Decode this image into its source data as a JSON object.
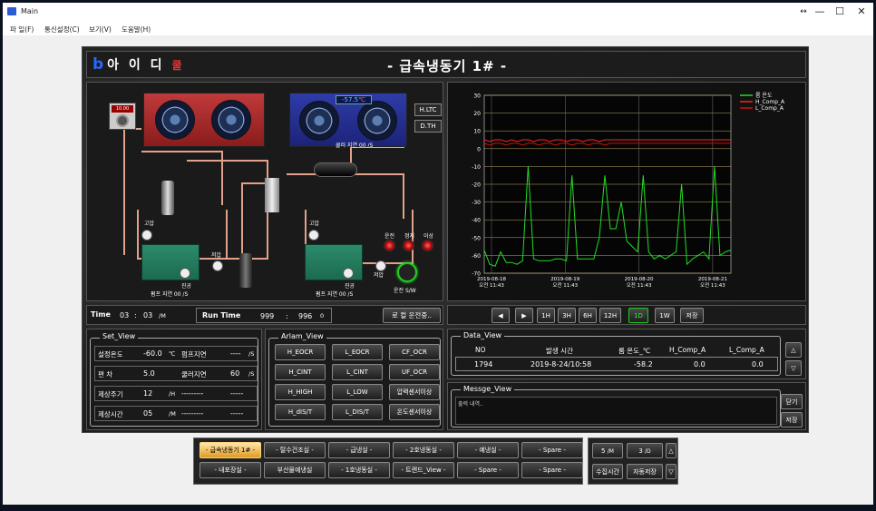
{
  "window": {
    "title": "Main",
    "controls": {
      "resize": "↔",
      "minimize": "—",
      "maximize": "☐",
      "close": "✕"
    }
  },
  "menu": [
    "파 일(F)",
    "통신설정(C)",
    "보기(V)",
    "도움말(H)"
  ],
  "header": {
    "logo_a": "b",
    "logo_b": "아 이 디",
    "logo_c": "쿨",
    "title": "- 급속냉동기 1# -"
  },
  "diagram": {
    "temp_small": "10.00",
    "temp_main": "-57.5",
    "temp_unit": "℃",
    "btn_hltc": "H.LTC",
    "btn_dth": "D.TH",
    "fan_delay": "쿨러 지연  00  /S",
    "left_high": "고압",
    "left_low": "저압",
    "left_vac": "진공",
    "left_pump": "펌프 지연  00  /S",
    "right_high": "고압",
    "right_low": "저압",
    "right_vac": "진공",
    "right_pump": "펌프 지연  00  /S",
    "led_labels": [
      "운전",
      "정지",
      "이상"
    ],
    "run_sw": "운전 S/W"
  },
  "chart_data": {
    "type": "line",
    "ylim": [
      -70,
      30
    ],
    "yticks": [
      "30",
      "20",
      "10",
      "0",
      "-10",
      "-20",
      "-30",
      "-40",
      "-50",
      "-60",
      "-70"
    ],
    "xticks": [
      [
        "2019-08-18",
        "오전 11:43"
      ],
      [
        "2019-08-19",
        "오전 11:43"
      ],
      [
        "2019-08-20",
        "오전 11:43"
      ],
      [
        "2019-08-21",
        "오전 11:43"
      ]
    ],
    "series": [
      {
        "name": "룸 온도",
        "color": "#22dd22",
        "values": [
          -57,
          -65,
          -66,
          -58,
          -64,
          -64,
          -65,
          -63,
          -10,
          -62,
          -63,
          -63,
          -63,
          -62,
          -62,
          -63,
          -15,
          -62,
          -62,
          -62,
          -62,
          -50,
          -15,
          -45,
          -45,
          -30,
          -52,
          -55,
          -58,
          -15,
          -58,
          -62,
          -60,
          -62,
          -60,
          -58,
          -20,
          -65,
          -62,
          -60,
          -58,
          -62,
          -10,
          -60,
          -58,
          -57
        ]
      },
      {
        "name": "H_Comp_A",
        "color": "#ff2222",
        "values": [
          5,
          4,
          5,
          5,
          4,
          5,
          4,
          5,
          5,
          4,
          5,
          5,
          4,
          5,
          5,
          4,
          5,
          5,
          4,
          5,
          5,
          4,
          5,
          5,
          5,
          5,
          5,
          5,
          5,
          5,
          5,
          5,
          5,
          5,
          5,
          5,
          5,
          5,
          5,
          5,
          5,
          5,
          5,
          5,
          5,
          5
        ]
      },
      {
        "name": "L_Comp_A",
        "color": "#cc1111",
        "values": [
          3,
          2,
          3,
          3,
          2,
          3,
          3,
          2,
          3,
          3,
          2,
          3,
          3,
          2,
          3,
          3,
          2,
          3,
          3,
          2,
          3,
          3,
          2,
          3,
          3,
          3,
          3,
          3,
          3,
          3,
          3,
          3,
          3,
          3,
          3,
          3,
          3,
          3,
          3,
          3,
          3,
          3,
          3,
          3,
          3,
          3
        ]
      }
    ]
  },
  "time": {
    "label": "Time",
    "h": "03",
    "sep": ":",
    "m": "03",
    "unit": "/M"
  },
  "runtime": {
    "label": "Run Time",
    "a": "999",
    "sep": ":",
    "b": "996",
    "c": "0"
  },
  "status_button": "로 컬 운전중..",
  "range_buttons": [
    "◀",
    "▶",
    "1H",
    "3H",
    "6H",
    "12H",
    "1D",
    "1W",
    "저장"
  ],
  "set_view": {
    "title": "Set_View",
    "rows": [
      {
        "label": "설정온도",
        "value": "-60.0",
        "unit": "℃",
        "label2": "펌프지연",
        "value2": "----",
        "unit2": "/S"
      },
      {
        "label": "편      차",
        "value": "5.0",
        "unit": "",
        "label2": "쿨러지연",
        "value2": "60",
        "unit2": "/S"
      },
      {
        "label": "제상주기",
        "value": "12",
        "unit": "/H",
        "label2": "---------",
        "value2": "-----",
        "unit2": ""
      },
      {
        "label": "제상시간",
        "value": "05",
        "unit": "/M",
        "label2": "---------",
        "value2": "-----",
        "unit2": ""
      }
    ]
  },
  "alarm_view": {
    "title": "Arlam_View",
    "buttons": [
      "H_EOCR",
      "L_EOCR",
      "CF_OCR",
      "H_CINT",
      "L_CINT",
      "UF_OCR",
      "H_HIGH",
      "L_LOW",
      "압력센서이상",
      "H_dIS/T",
      "L_DIS/T",
      "온도센서이상"
    ]
  },
  "data_view": {
    "title": "Data_View",
    "headers": [
      "NO",
      "발생 시간",
      "룸 온도_℃",
      "H_Comp_A",
      "L_Comp_A"
    ],
    "row": [
      "1794",
      "2019-8-24/10:58",
      "-58.2",
      "0.0",
      "0.0"
    ],
    "up": "△",
    "down": "▽"
  },
  "message_view": {
    "title": "Messge_View",
    "text": "출력 내역..",
    "close": "닫기",
    "save": "저장"
  },
  "nav": {
    "row1": [
      "- 급속냉동기 1# -",
      "- 탈수건조실 -",
      "- 급냉실 -",
      "- 2호냉동실 -",
      "- 예냉실 -",
      "- Spare -"
    ],
    "row2": [
      "- 내포장실 -",
      "부산물예냉실",
      "- 1호냉동실 -",
      "- 트렌드_View -",
      "- Spare -",
      "- Spare -"
    ]
  },
  "side": {
    "a": "5",
    "a_unit": "/M",
    "b": "3",
    "b_unit": "/D",
    "up": "△",
    "collect": "수집시간",
    "auto_save": "자동저장",
    "down": "▽"
  }
}
